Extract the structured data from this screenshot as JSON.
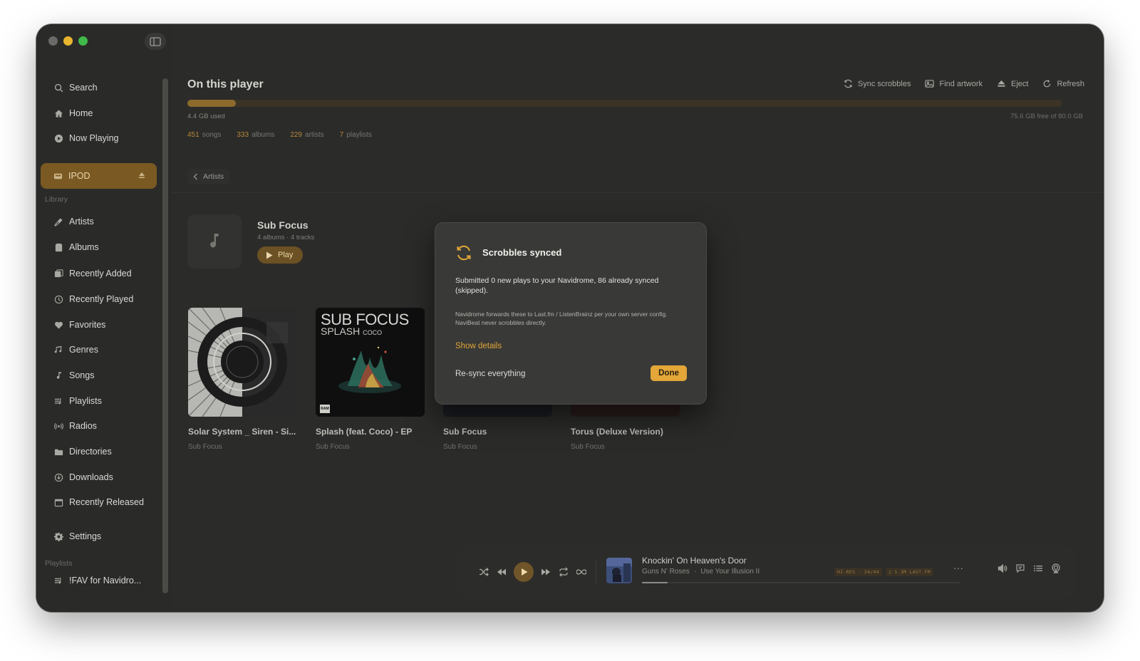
{
  "sidebar": {
    "search": "Search",
    "home": "Home",
    "now_playing": "Now Playing",
    "device": "IPOD",
    "library_label": "Library",
    "items": [
      {
        "label": "Artists",
        "icon": "mic-icon"
      },
      {
        "label": "Albums",
        "icon": "album-icon"
      },
      {
        "label": "Recently Added",
        "icon": "recently-added-icon"
      },
      {
        "label": "Recently Played",
        "icon": "history-icon"
      },
      {
        "label": "Favorites",
        "icon": "heart-icon"
      },
      {
        "label": "Genres",
        "icon": "genres-icon"
      },
      {
        "label": "Songs",
        "icon": "note-icon"
      },
      {
        "label": "Playlists",
        "icon": "playlist-icon"
      },
      {
        "label": "Radios",
        "icon": "radio-icon"
      },
      {
        "label": "Directories",
        "icon": "folder-icon"
      },
      {
        "label": "Downloads",
        "icon": "download-icon"
      },
      {
        "label": "Recently Released",
        "icon": "calendar-icon"
      }
    ],
    "settings": "Settings",
    "playlists_label": "Playlists",
    "playlist_item": "!FAV for Navidro..."
  },
  "header": {
    "title": "On this player",
    "toolbar": {
      "sync": "Sync scrobbles",
      "artwork": "Find artwork",
      "eject": "Eject",
      "refresh": "Refresh"
    }
  },
  "storage": {
    "used_label": "4.4 GB used",
    "free_label": "75.6 GB free of 80.0 GB",
    "used_fraction": 0.055
  },
  "stats": [
    {
      "n": "451",
      "label": "songs"
    },
    {
      "n": "333",
      "label": "albums"
    },
    {
      "n": "229",
      "label": "artists"
    },
    {
      "n": "7",
      "label": "playlists"
    }
  ],
  "back_label": "Artists",
  "artist": {
    "name": "Sub Focus",
    "meta": "4 albums · 4 tracks",
    "play": "Play"
  },
  "albums": [
    {
      "title": "Solar System _ Siren - Si...",
      "artist": "Sub Focus"
    },
    {
      "title": "Splash (feat. Coco) - EP",
      "artist": "Sub Focus",
      "cover_text_1": "SUB FOCUS",
      "cover_text_2": "SPLASH",
      "cover_text_3": "COCO",
      "cover_text_4": "RAM"
    },
    {
      "title": "Sub Focus",
      "artist": "Sub Focus"
    },
    {
      "title": "Torus (Deluxe Version)",
      "artist": "Sub Focus"
    }
  ],
  "dialog": {
    "title": "Scrobbles synced",
    "body": "Submitted 0 new plays to your Navidrome, 86 already synced (skipped).",
    "note": "Navidrome forwards these to Last.fm / ListenBrainz per your own server config. NaviBeat never scrobbles directly.",
    "details": "Show details",
    "resync": "Re-sync everything",
    "done": "Done"
  },
  "player": {
    "title": "Knockin' On Heaven's Door",
    "artist": "Guns N' Roses",
    "sep": "·",
    "album": "Use Your Illusion II",
    "badge_quality": "HI-RES · 24/44",
    "badge_scrobble": "♫ 1.3M LAST.FM",
    "more": "···",
    "progress": 0.08
  },
  "colors": {
    "accent": "#e3a638",
    "window_bg": "#2b2b29",
    "sidebar_active": "#7a5a22"
  }
}
